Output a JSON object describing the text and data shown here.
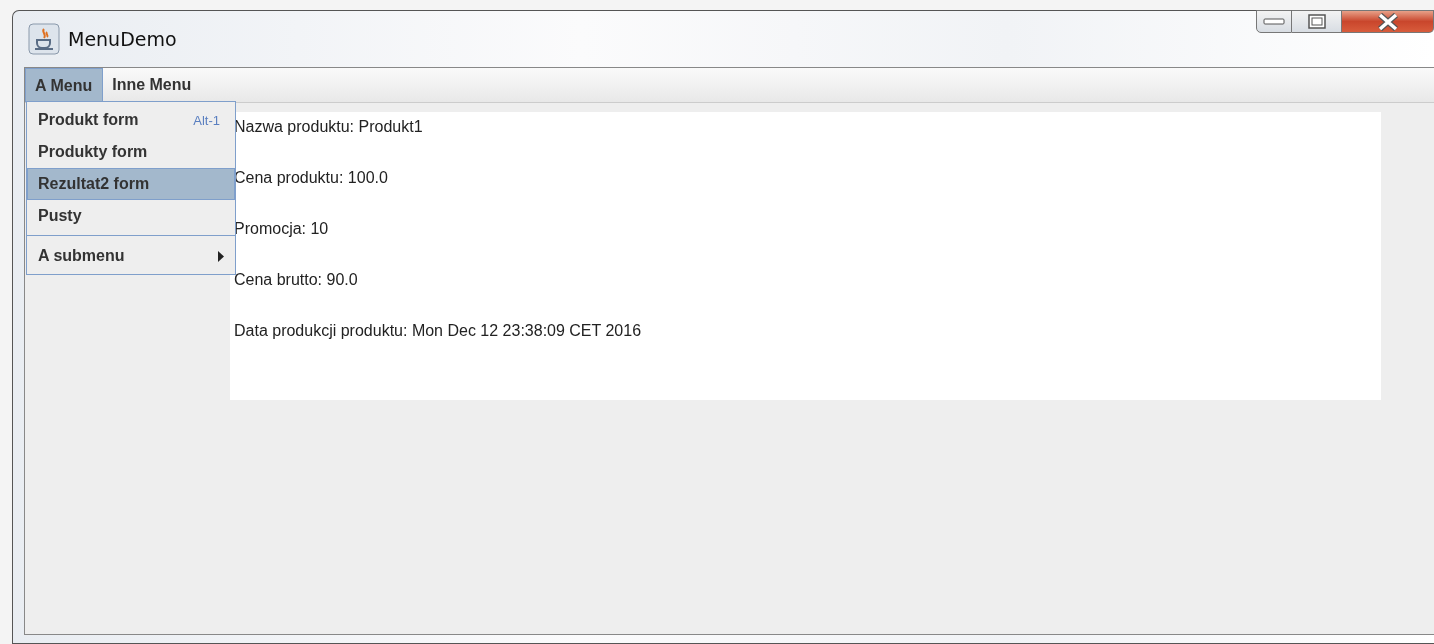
{
  "window": {
    "title": "MenuDemo"
  },
  "menubar": [
    {
      "label": "A Menu",
      "selected": true
    },
    {
      "label": "Inne Menu",
      "selected": false
    }
  ],
  "popup_menu": [
    {
      "kind": "item",
      "label": "Produkt form",
      "accelerator": "Alt-1",
      "selected": false
    },
    {
      "kind": "item",
      "label": "Produkty form",
      "selected": false
    },
    {
      "kind": "item",
      "label": "Rezultat2 form",
      "selected": true
    },
    {
      "kind": "item",
      "label": "Pusty",
      "selected": false
    },
    {
      "kind": "separator"
    },
    {
      "kind": "submenu",
      "label": "A submenu",
      "selected": false
    }
  ],
  "content": {
    "lines": [
      "Nazwa produktu: Produkt1",
      "Cena produktu: 100.0",
      "Promocja: 10",
      "Cena brutto: 90.0",
      "Data produkcji produktu: Mon Dec 12 23:38:09 CET 2016"
    ]
  }
}
